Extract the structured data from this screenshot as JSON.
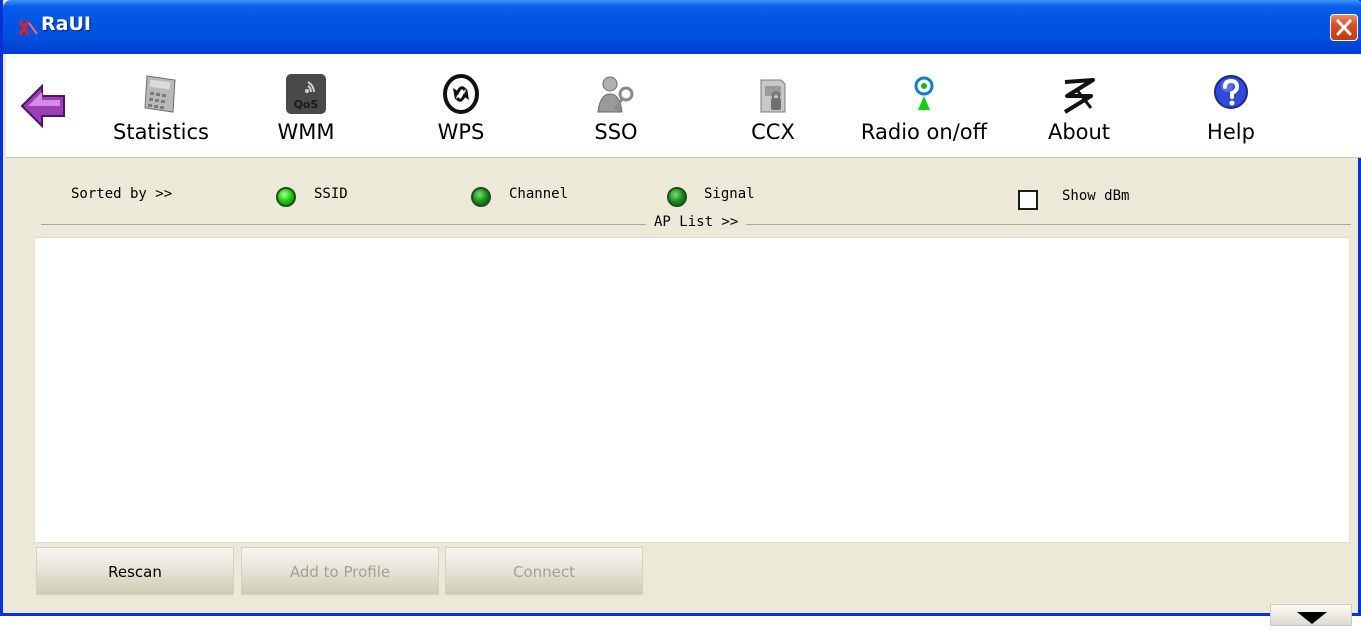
{
  "window": {
    "title": "RaUI",
    "accent_color": "#0055e5"
  },
  "toolbar": {
    "back_icon": "back-arrow-icon",
    "items": [
      {
        "label": "Statistics",
        "icon": "calculator-icon"
      },
      {
        "label": "WMM",
        "icon": "qos-icon"
      },
      {
        "label": "WPS",
        "icon": "wps-icon"
      },
      {
        "label": "SSO",
        "icon": "user-key-icon"
      },
      {
        "label": "CCX",
        "icon": "ccx-icon"
      },
      {
        "label": "Radio on/off",
        "icon": "antenna-icon"
      },
      {
        "label": "About",
        "icon": "ralink-logo-icon"
      },
      {
        "label": "Help",
        "icon": "help-icon"
      }
    ]
  },
  "sort": {
    "label": "Sorted by >>",
    "options": [
      {
        "label": "SSID",
        "selected": true
      },
      {
        "label": "Channel",
        "selected": false
      },
      {
        "label": "Signal",
        "selected": false
      }
    ],
    "show_dbm_label": "Show dBm",
    "show_dbm_checked": false
  },
  "ap_list": {
    "label": "AP List >>",
    "items": []
  },
  "buttons": {
    "rescan": "Rescan",
    "add_to_profile": "Add to Profile",
    "connect": "Connect"
  }
}
